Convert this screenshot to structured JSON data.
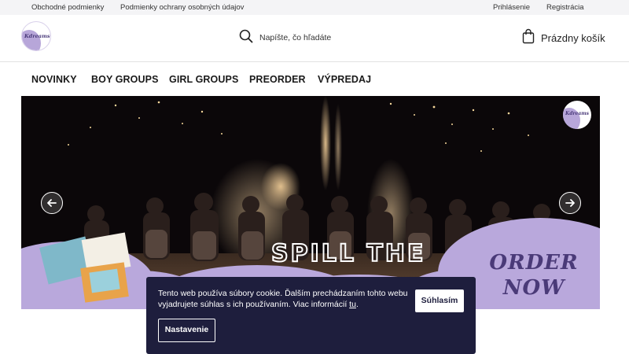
{
  "topbar": {
    "links_left": [
      "Obchodné podmienky",
      "Podmienky ochrany osobných údajov"
    ],
    "links_right": [
      "Prihlásenie",
      "Registrácia"
    ]
  },
  "header": {
    "logo_text": "Kdreams",
    "search_placeholder": "Napíšte, čo hľadáte",
    "cart_label": "Prázdny košík"
  },
  "nav": {
    "items": [
      "NOVINKY",
      "BOY GROUPS",
      "GIRL GROUPS",
      "PREORDER",
      "VÝPREDAJ"
    ]
  },
  "hero": {
    "logo_text": "Kdreams",
    "banner_text": "SPILL THE",
    "order_line1": "ORDER",
    "order_line2": "NOW"
  },
  "cookie": {
    "message": "Tento web používa súbory cookie. Ďalším prechádzaním tohto webu vyjadrujete súhlas s ich používaním. Viac informácií ",
    "link_label": "tu",
    "message_end": ".",
    "accept_label": "Súhlasím",
    "settings_label": "Nastavenie"
  },
  "colors": {
    "cookie_bg": "#1e1e3d",
    "accent_lavender": "#b7a6d9",
    "order_text": "#4a3a78"
  }
}
